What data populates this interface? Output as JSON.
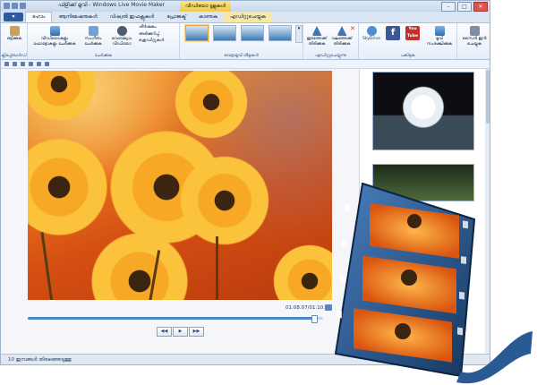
{
  "window": {
    "title": "ഫ്ളിക്ക് മൂവി - Windows Live Movie Maker",
    "context_tab_title": "വീഡിയോ ടൂളുകൾ"
  },
  "tabs": [
    {
      "label": "ഹോം",
      "active": true
    },
    {
      "label": "ആനിമേഷനുകൾ",
      "active": false
    },
    {
      "label": "വിഷ്വൽ ഇഫക്റ്റുകൾ",
      "active": false
    },
    {
      "label": "പ്രോജക്ട്",
      "active": false
    },
    {
      "label": "കാണുക",
      "active": false
    },
    {
      "label": "എഡിറ്റുചെയ്യുക",
      "active": false,
      "contextual": true
    }
  ],
  "ribbon": {
    "clipboard": {
      "paste_label": "ഒട്ടിക്കുക",
      "group_label": "ക്ലിപ്പ്ബോർഡ്"
    },
    "add": {
      "videos_label": "വീഡിയോകളും ഫോട്ടോകളും ചേർക്കുക",
      "music_label": "സംഗീതം ചേർക്കുക",
      "webcam_label": "വെബ്ക്യാം വീഡിയോ",
      "small_items": [
        "ശീർഷകം",
        "അടിക്കുറിപ്പ്",
        "ക്രെഡിറ്റുകൾ"
      ],
      "group_label": "ചേർക്കുക"
    },
    "themes": {
      "group_label": "ഓട്ടോമൂവി തീമുകൾ"
    },
    "editing": {
      "rotate_left_label": "ഇടത്തേക്ക് തിരിക്കുക",
      "rotate_right_label": "വലത്തേക്ക് തിരിക്കുക",
      "group_label": "എഡിറ്റുചെയ്യുന്നു"
    },
    "share": {
      "skydrive_label": "SkyDrive",
      "youtube_label": "You Tube",
      "group_label": "പങ്കിടുക"
    },
    "save": {
      "save_movie_label": "മൂവി സംരക്ഷിക്കുക",
      "signin_label": "സൈൻ ഇൻ ചെയ്യുക"
    }
  },
  "player": {
    "time": "01:08.07/01:10.00",
    "progress_fraction": 0.97,
    "controls": [
      "◀◀",
      "▶",
      "▶▶"
    ]
  },
  "status": {
    "text": "10 ഇനങ്ങൾ തിരഞ്ഞെടുത്തു"
  },
  "colors": {
    "accent": "#2d5a9e",
    "ribbon_bg": "#e6eef8",
    "context_tab": "#ebc94c"
  }
}
